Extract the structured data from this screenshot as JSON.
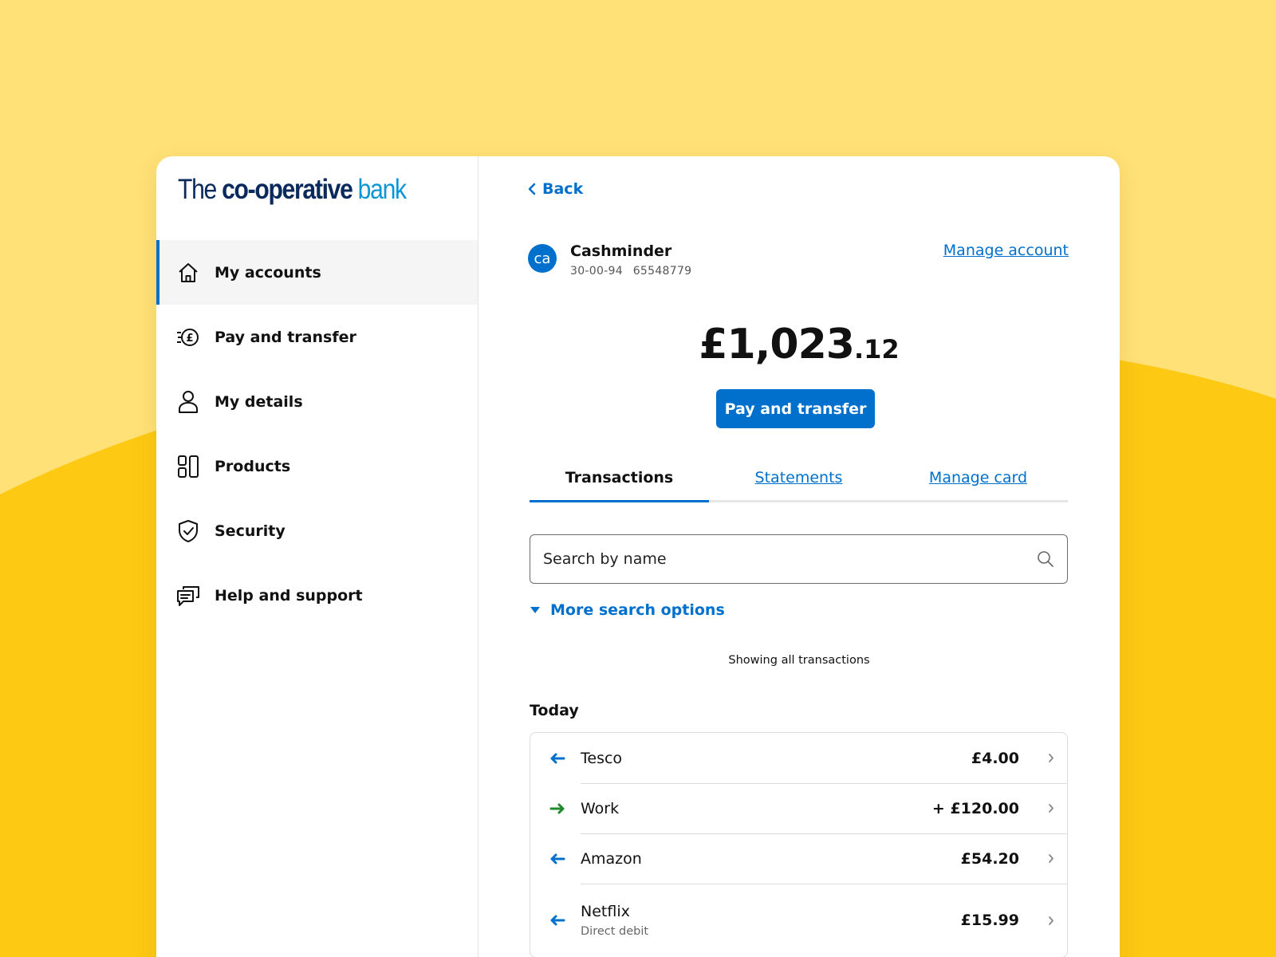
{
  "colors": {
    "background_light": "#FFE177",
    "background_dark": "#FDC913",
    "accent": "#0070CC",
    "incoming": "#1F8A2A",
    "text": "#111111"
  },
  "logo": {
    "part1": "The",
    "part2": "co-operative",
    "part3": "bank"
  },
  "sidebar": {
    "items": [
      {
        "label": "My accounts",
        "icon": "home-icon",
        "active": true
      },
      {
        "label": "Pay and transfer",
        "icon": "pound-coin-icon",
        "active": false
      },
      {
        "label": "My details",
        "icon": "person-icon",
        "active": false
      },
      {
        "label": "Products",
        "icon": "products-grid-icon",
        "active": false
      },
      {
        "label": "Security",
        "icon": "shield-check-icon",
        "active": false
      },
      {
        "label": "Help and support",
        "icon": "chat-bubbles-icon",
        "active": false
      }
    ]
  },
  "main": {
    "back_label": "Back",
    "account": {
      "avatar_text": "ca",
      "name": "Cashminder",
      "sort_code": "30-00-94",
      "account_number": "65548779",
      "manage_label": "Manage account"
    },
    "balance": {
      "major": "£1,023",
      "minor": ".12"
    },
    "pay_button_label": "Pay and transfer",
    "tabs": [
      {
        "label": "Transactions",
        "active": true
      },
      {
        "label": "Statements",
        "active": false
      },
      {
        "label": "Manage card",
        "active": false
      }
    ],
    "search": {
      "placeholder": "Search by name",
      "value": ""
    },
    "more_options_label": "More search options",
    "showing_text": "Showing all transactions",
    "group_title": "Today",
    "transactions": [
      {
        "name": "Tesco",
        "sub": "",
        "amount": "£4.00",
        "direction": "out"
      },
      {
        "name": "Work",
        "sub": "",
        "amount": "+ £120.00",
        "direction": "in"
      },
      {
        "name": "Amazon",
        "sub": "",
        "amount": "£54.20",
        "direction": "out"
      },
      {
        "name": "Netflix",
        "sub": "Direct debit",
        "amount": "£15.99",
        "direction": "out"
      }
    ]
  }
}
